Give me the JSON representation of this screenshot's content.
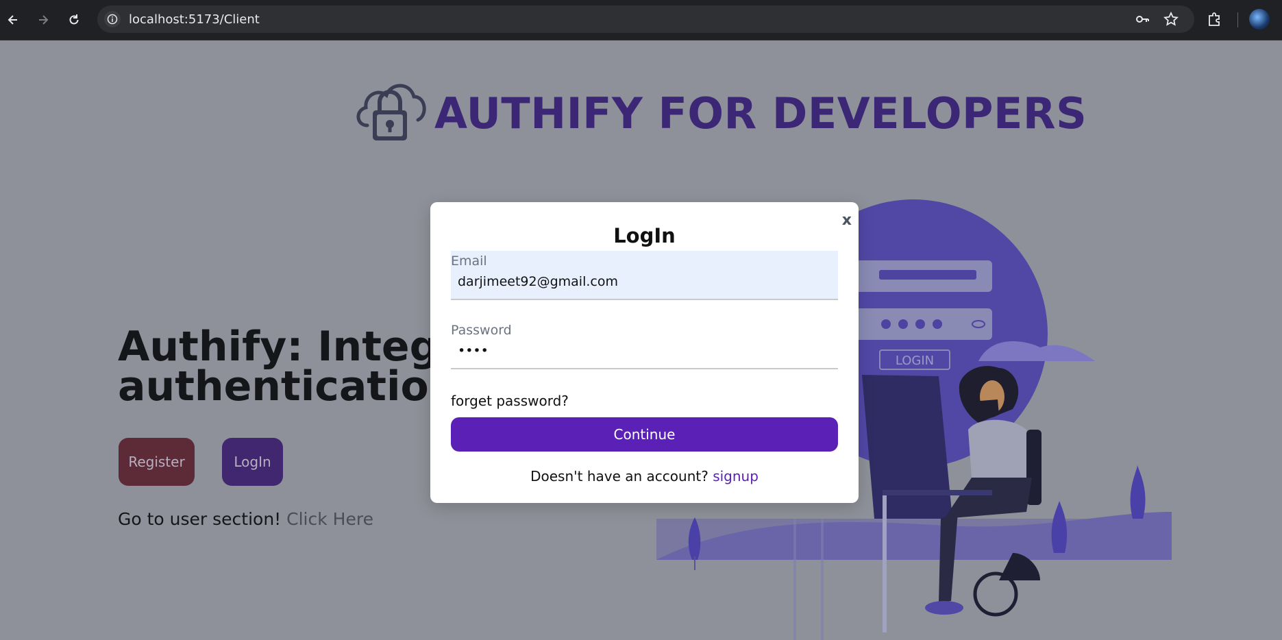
{
  "browser": {
    "url": "localhost:5173/Client",
    "icons": [
      "back-arrow-icon",
      "forward-arrow-icon",
      "reload-icon",
      "info-icon",
      "key-icon",
      "star-icon",
      "extensions-icon",
      "profile-avatar"
    ]
  },
  "page": {
    "brand_title": "AUTHIFY FOR DEVELOPERS",
    "hero_heading_line1": "Authify: Integrate",
    "hero_heading_line2": "authentication in",
    "register_label": "Register",
    "login_label": "LogIn",
    "user_section_text": "Go to user section!",
    "user_section_link": "Click Here"
  },
  "illustration": {
    "login_badge": "LOGIN"
  },
  "modal": {
    "close_label": "x",
    "title": "LogIn",
    "email_label": "Email",
    "email_value": "darjimeet92@gmail.com",
    "password_label": "Password",
    "password_value": "••••",
    "forget_password": "forget password?",
    "continue_label": "Continue",
    "signup_prompt": "Doesn't have an account?",
    "signup_link": "signup"
  },
  "colors": {
    "brand_purple": "#3c2776",
    "continue_purple": "#5b21b6",
    "register_bg": "#5c2b37",
    "overlay_bg": "#8e9199"
  }
}
